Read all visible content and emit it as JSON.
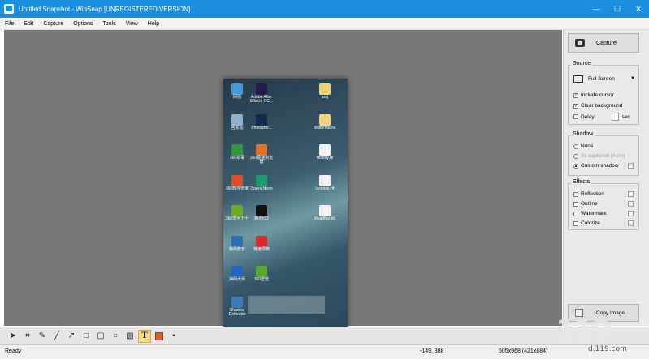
{
  "window": {
    "title": "Untitled Snapshot - WinSnap  [UNREGISTERED VERSION]",
    "minimize": "—",
    "maximize": "☐",
    "close": "✕"
  },
  "menu": [
    "File",
    "Edit",
    "Capture",
    "Options",
    "Tools",
    "View",
    "Help"
  ],
  "desktop_icons": [
    {
      "label": "网络",
      "color": "#3f9ad6"
    },
    {
      "label": "Adobe After Effects CC...",
      "color": "#2a1a4a"
    },
    {
      "label": "ang",
      "color": "#f1d37a"
    },
    {
      "label": "回收站",
      "color": "#8fb1cc"
    },
    {
      "label": "Photosho...",
      "color": "#0f2c4b"
    },
    {
      "label": "Watermarks",
      "color": "#f1d37a"
    },
    {
      "label": "360杀毒",
      "color": "#2e9a3a"
    },
    {
      "label": "360极速浏览器",
      "color": "#e6702a"
    },
    {
      "label": "History.rtf",
      "color": "#f2f2f2"
    },
    {
      "label": "360软件管家",
      "color": "#e14c2b"
    },
    {
      "label": "Opera Neon",
      "color": "#1c9a70"
    },
    {
      "label": "License.rtf",
      "color": "#f2f2f2"
    },
    {
      "label": "360安全卫士",
      "color": "#6cab22"
    },
    {
      "label": "腾讯QQ",
      "color": "#111111"
    },
    {
      "label": "ReadMe.txt",
      "color": "#f2f2f2"
    },
    {
      "label": "暴风影音",
      "color": "#2b6fb6"
    },
    {
      "label": "有道词典",
      "color": "#e0262a"
    },
    {
      "label": "净网大师",
      "color": "#2566c2"
    },
    {
      "label": "360壁纸",
      "color": "#57a82c"
    },
    {
      "label": "Shadow Defender",
      "color": "#3b7bb6"
    }
  ],
  "sidebar": {
    "capture_label": "Capture",
    "source": {
      "title": "Source",
      "selected": "Full Screen",
      "include_cursor": {
        "label": "Include cursor",
        "checked": true
      },
      "clear_background": {
        "label": "Clear background",
        "checked": true
      },
      "delay": {
        "label": "Delay:",
        "unit": "sec",
        "checked": false
      }
    },
    "shadow": {
      "title": "Shadow",
      "options": [
        {
          "label": "None",
          "selected": false
        },
        {
          "label": "As captured (Aero)",
          "selected": false
        },
        {
          "label": "Custom shadow",
          "selected": true
        }
      ]
    },
    "effects": {
      "title": "Effects",
      "items": [
        "Reflection",
        "Outline",
        "Watermark",
        "Colorize"
      ]
    },
    "copy_label": "Copy Image"
  },
  "toolbar": {
    "tools": [
      "select-arrow",
      "crop",
      "pen",
      "line",
      "arrow",
      "rectangle",
      "rounded-rectangle",
      "ellipse",
      "hatch-fill",
      "text"
    ],
    "color": "#f15a1b"
  },
  "status": {
    "left": "Ready",
    "coords": "-149, 388",
    "size": "505x968 (421x884)"
  },
  "watermark": {
    "site": "d.119.com"
  }
}
